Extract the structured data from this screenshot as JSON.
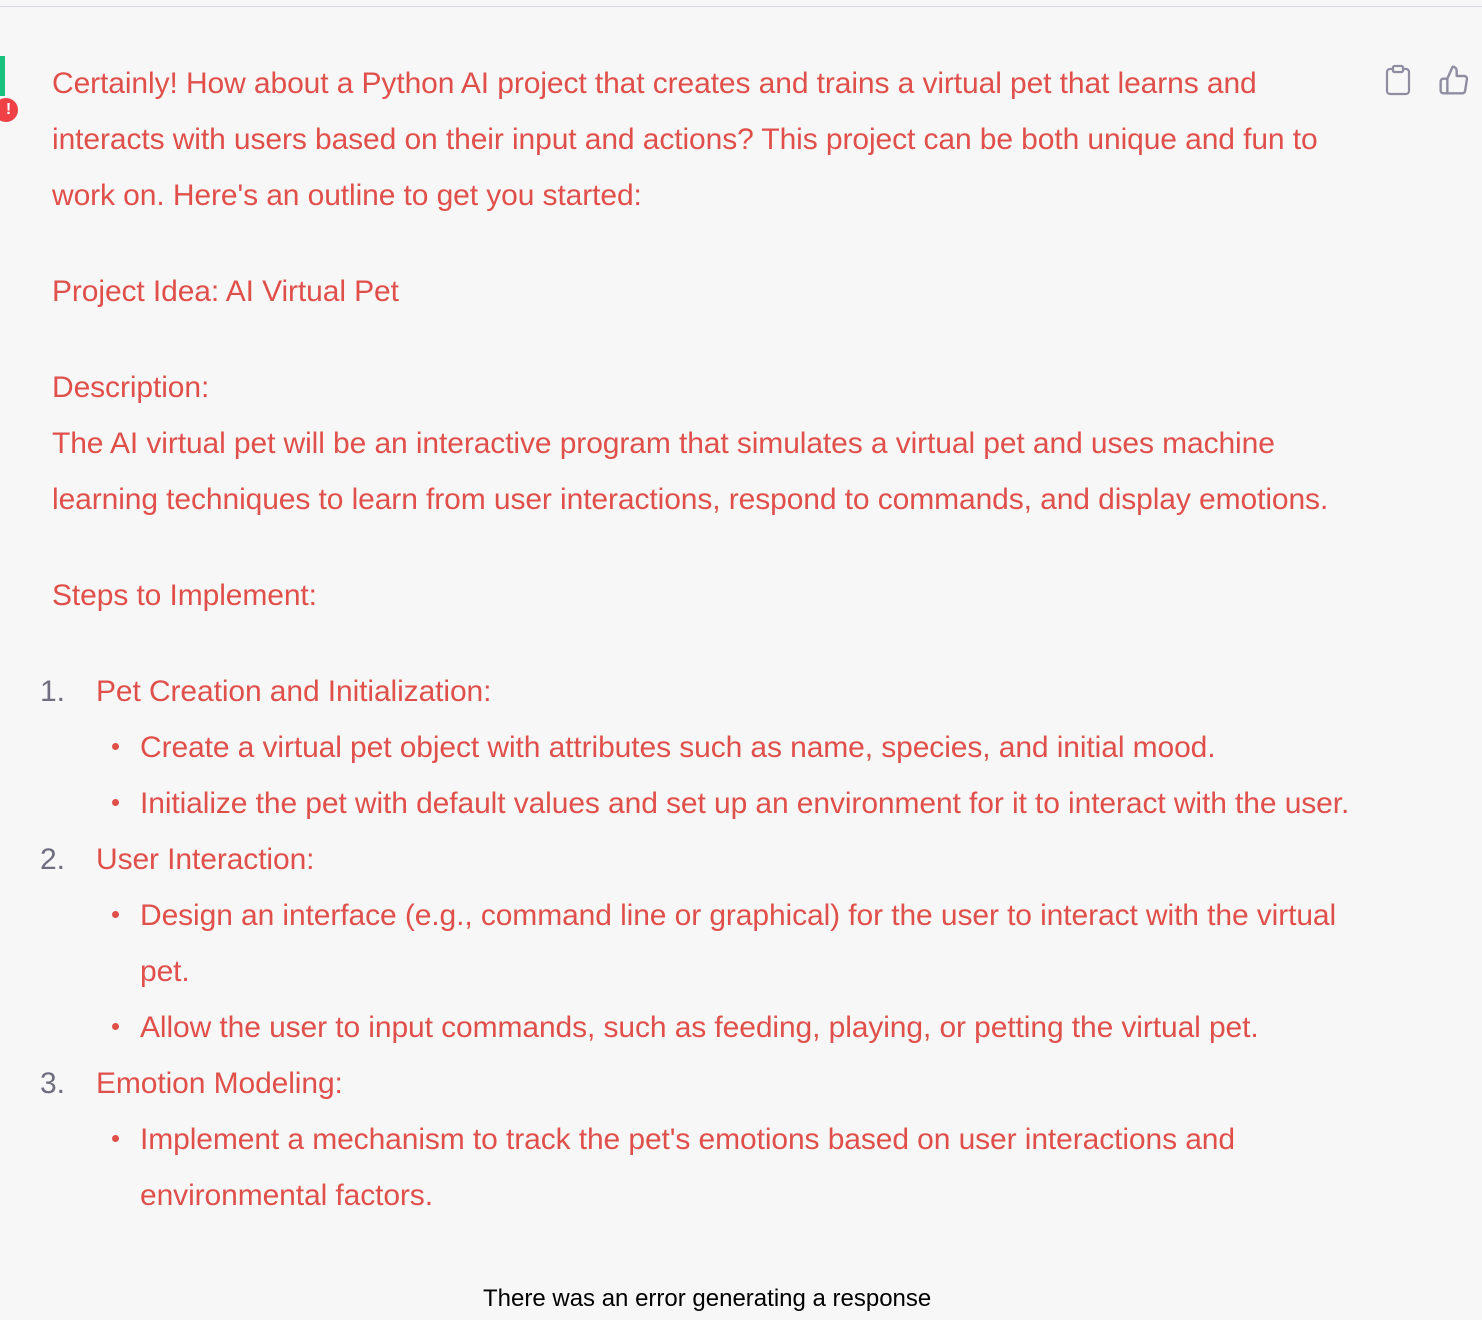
{
  "message": {
    "intro": "Certainly! How about a Python AI project that creates and trains a virtual pet that learns and interacts with users based on their input and actions? This project can be both unique and fun to work on. Here's an outline to get you started:",
    "project_idea": "Project Idea: AI Virtual Pet",
    "description_heading": "Description:",
    "description_body": "The AI virtual pet will be an interactive program that simulates a virtual pet and uses machine learning techniques to learn from user interactions, respond to commands, and display emotions.",
    "steps_heading": "Steps to Implement:",
    "steps": [
      {
        "number": "1.",
        "title": "Pet Creation and Initialization:",
        "bullets": [
          "Create a virtual pet object with attributes such as name, species, and initial mood.",
          "Initialize the pet with default values and set up an environment for it to interact with the user."
        ]
      },
      {
        "number": "2.",
        "title": "User Interaction:",
        "bullets": [
          "Design an interface (e.g., command line or graphical) for the user to interact with the virtual pet.",
          "Allow the user to input commands, such as feeding, playing, or petting the virtual pet."
        ]
      },
      {
        "number": "3.",
        "title": "Emotion Modeling:",
        "bullets": [
          "Implement a mechanism to track the pet's emotions based on user interactions and environmental factors."
        ]
      }
    ]
  },
  "error_badge": "!",
  "error_message": "There was an error generating a response",
  "icons": {
    "copy": "clipboard-icon",
    "like": "thumbs-up-icon"
  },
  "colors": {
    "error_text": "#e0504b",
    "background": "#f7f7f8",
    "avatar_accent": "#19c37d",
    "badge": "#ef4146",
    "number_gray": "#6e6e80"
  }
}
